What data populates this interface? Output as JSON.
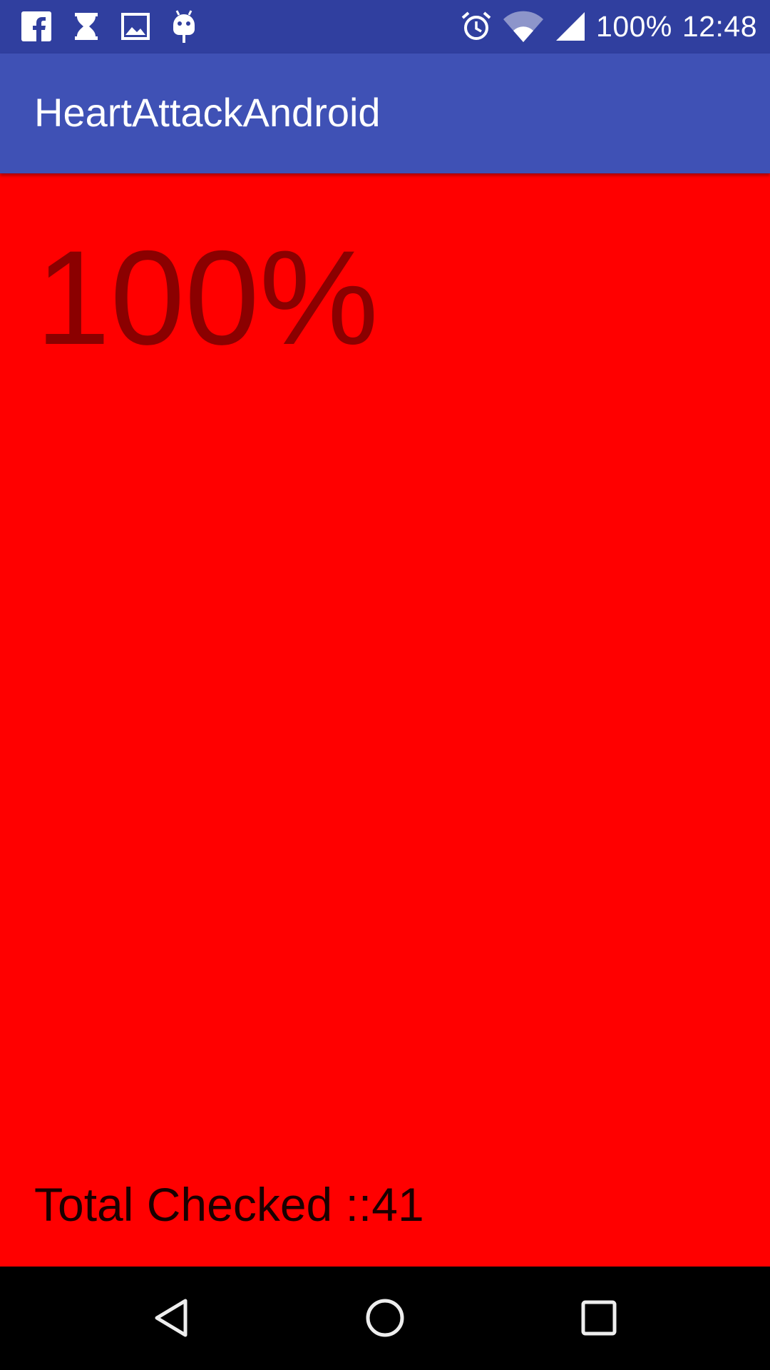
{
  "status_bar": {
    "battery": "100%",
    "time": "12:48",
    "left_icons": [
      "facebook-icon",
      "hourglass-icon",
      "image-icon",
      "android-debug-icon"
    ],
    "right_icons": [
      "alarm-icon",
      "wifi-icon",
      "cell-signal-icon"
    ],
    "background": "#303F9F"
  },
  "app_bar": {
    "title": "HeartAttackAndroid",
    "background": "#3F51B5"
  },
  "main": {
    "percent_label": "100%",
    "total_checked_label": "Total Checked ::41",
    "background": "#FF0000",
    "percent_color": "#8B0000"
  },
  "nav_bar": {
    "buttons": [
      "back-icon",
      "home-icon",
      "recents-icon"
    ]
  }
}
